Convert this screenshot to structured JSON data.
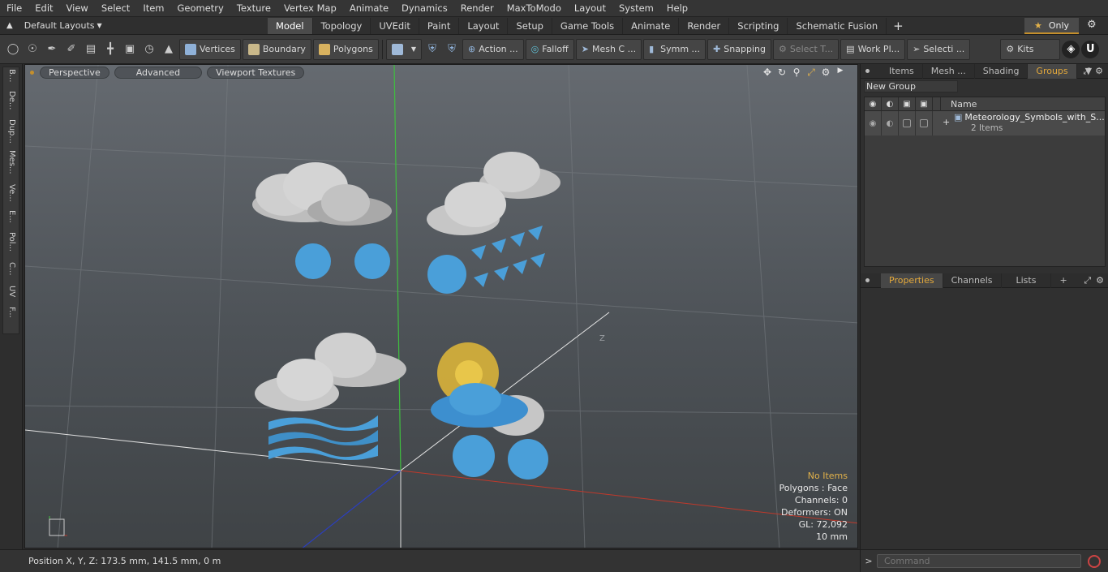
{
  "menu": [
    "File",
    "Edit",
    "View",
    "Select",
    "Item",
    "Geometry",
    "Texture",
    "Vertex Map",
    "Animate",
    "Dynamics",
    "Render",
    "MaxToModo",
    "Layout",
    "System",
    "Help"
  ],
  "layout_selector": "Default Layouts",
  "tabs": [
    {
      "label": "Model",
      "active": true
    },
    {
      "label": "Topology",
      "active": false
    },
    {
      "label": "UVEdit",
      "active": false
    },
    {
      "label": "Paint",
      "active": false
    },
    {
      "label": "Layout",
      "active": false
    },
    {
      "label": "Setup",
      "active": false
    },
    {
      "label": "Game Tools",
      "active": false
    },
    {
      "label": "Animate",
      "active": false
    },
    {
      "label": "Render",
      "active": false
    },
    {
      "label": "Scripting",
      "active": false
    },
    {
      "label": "Schematic Fusion",
      "active": false
    }
  ],
  "only_label": "Only",
  "toolbar": {
    "vertices": "Vertices",
    "boundary": "Boundary",
    "polygons": "Polygons",
    "action": "Action ...",
    "falloff": "Falloff",
    "mesh_c": "Mesh C ...",
    "symm": "Symm ...",
    "snapping": "Snapping",
    "select_t": "Select T...",
    "work_pl": "Work Pl...",
    "selecti": "Selecti ...",
    "kits": "Kits"
  },
  "left_tabs": [
    "B...",
    "De...",
    "Dup...",
    "Mes...",
    "Ve...",
    "E...",
    "Pol...",
    "C...",
    "UV",
    "F..."
  ],
  "viewport": {
    "tabs": [
      "Perspective",
      "Advanced",
      "Viewport Textures"
    ],
    "info": {
      "items": "No Items",
      "polygons": "Polygons : Face",
      "channels": "Channels: 0",
      "deformers": "Deformers: ON",
      "gl": "GL: 72,092",
      "scale": "10 mm"
    },
    "axis_label": "Z"
  },
  "status": {
    "position": "Position X, Y, Z:  173.5 mm, 141.5 mm, 0 m"
  },
  "right_panel": {
    "top_tabs": [
      {
        "label": "Items",
        "active": false
      },
      {
        "label": "Mesh ...",
        "active": false
      },
      {
        "label": "Shading",
        "active": false
      },
      {
        "label": "Groups",
        "active": true
      }
    ],
    "new_group": "New Group",
    "col_name": "Name",
    "group_name": "Meteorology_Symbols_with_S...",
    "group_count": "2 Items",
    "bottom_tabs": [
      {
        "label": "Properties",
        "active": true
      },
      {
        "label": "Channels",
        "active": false
      },
      {
        "label": "Lists",
        "active": false
      }
    ],
    "command_placeholder": "Command"
  }
}
